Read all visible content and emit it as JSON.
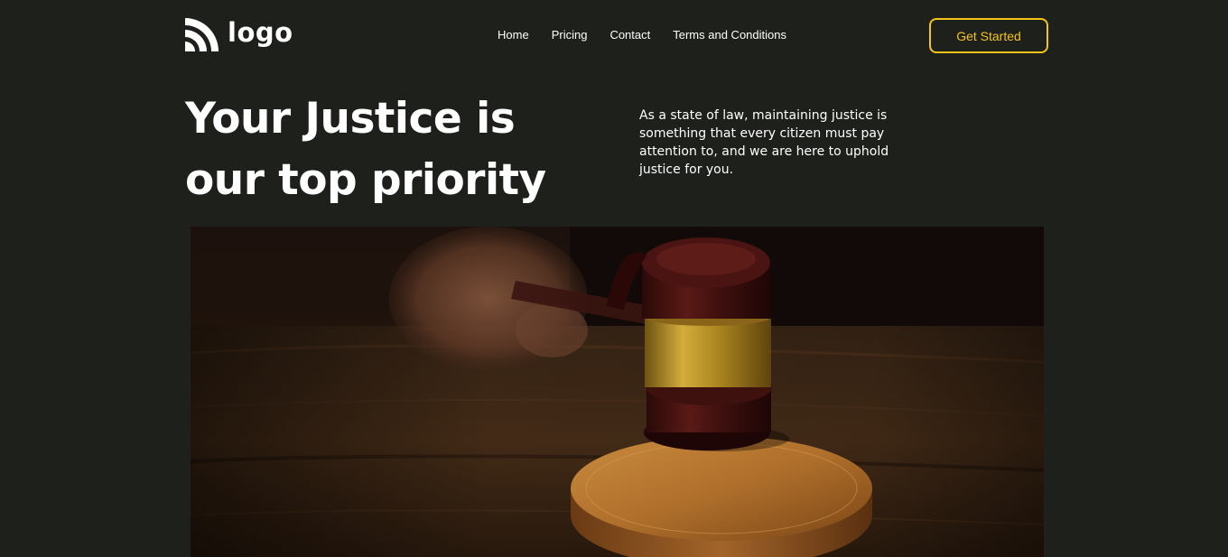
{
  "header": {
    "logo_text": "logo",
    "logo_icon": "rss-arcs-icon",
    "nav": [
      {
        "label": "Home"
      },
      {
        "label": "Pricing"
      },
      {
        "label": "Contact"
      },
      {
        "label": "Terms and Conditions"
      }
    ],
    "cta_label": "Get Started"
  },
  "hero": {
    "title_line1": "Your Justice is",
    "title_line2": "our top priority",
    "description": "As a state of law, maintaining justice is something that every citizen must pay attention to, and we are here to uphold justice for you."
  },
  "colors": {
    "background": "#1e201c",
    "accent": "#f4c518",
    "text": "#ffffff"
  }
}
